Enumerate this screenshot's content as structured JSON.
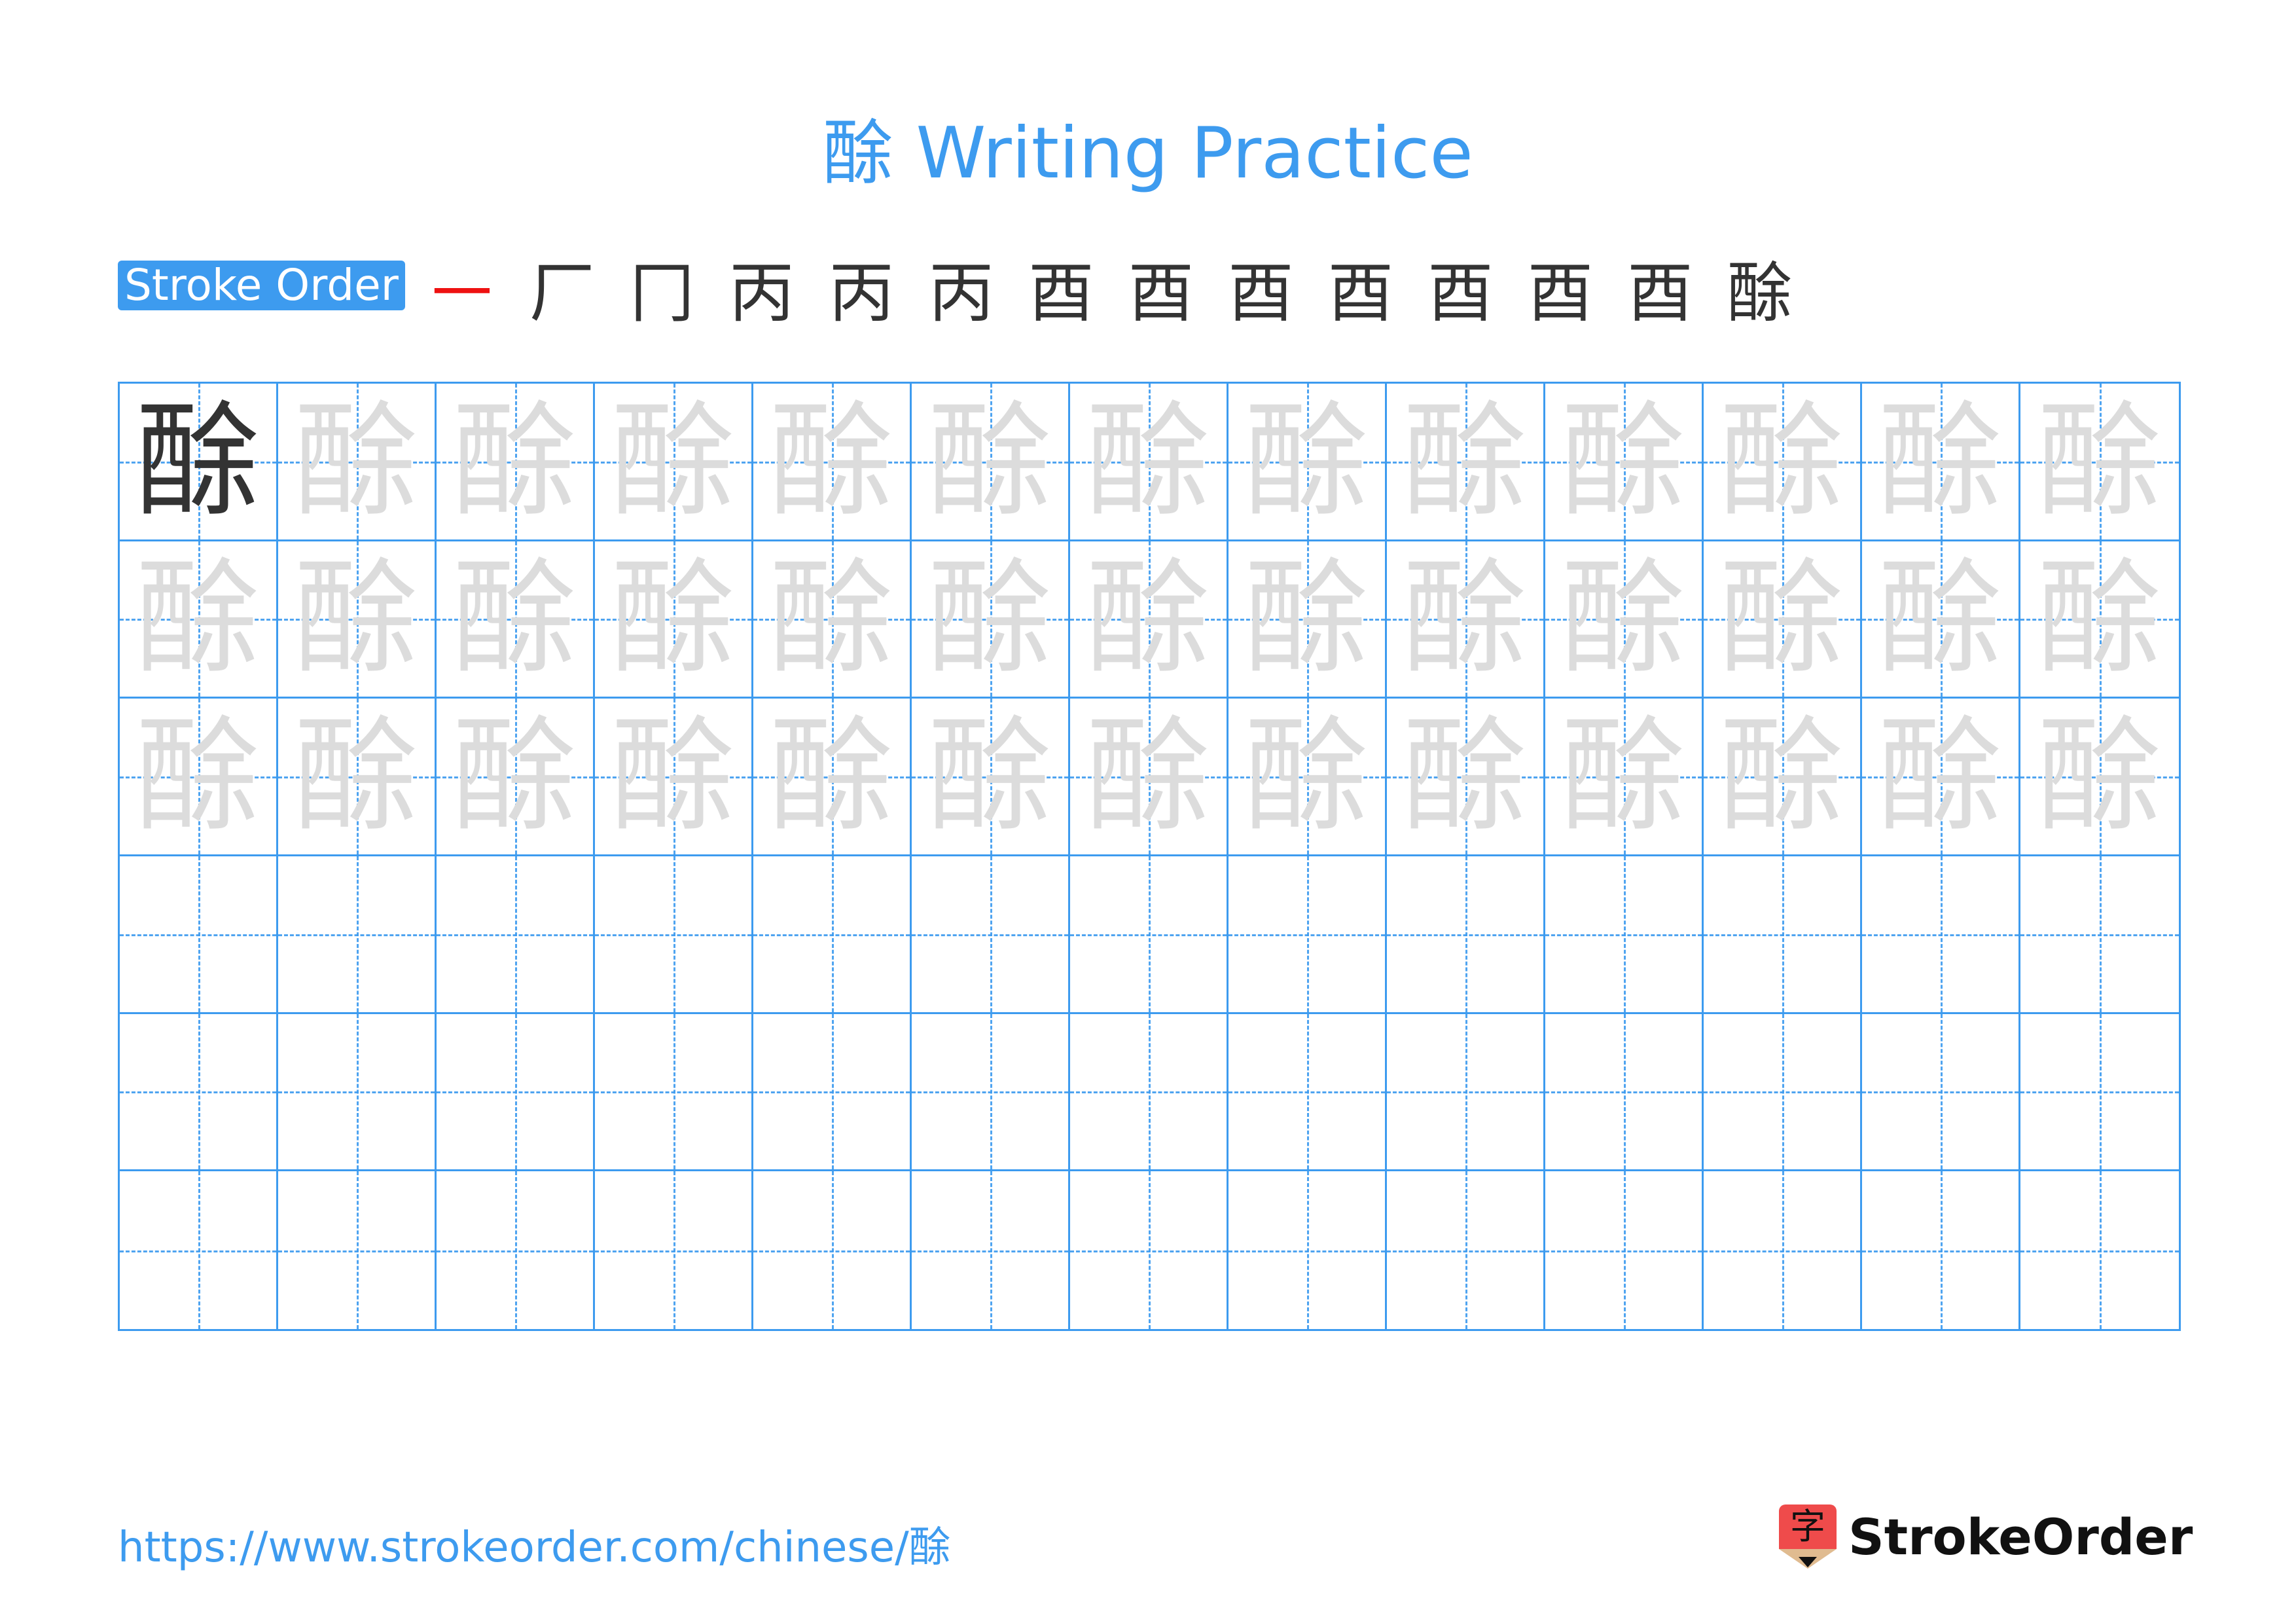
{
  "header": {
    "title": "酴 Writing Practice"
  },
  "stroke_order": {
    "label": "Stroke Order",
    "steps": [
      "㇐",
      "厂",
      "冂",
      "丙",
      "丙",
      "丙",
      "酉",
      "酉",
      "酉",
      "酉",
      "酉",
      "酉",
      "酉",
      "酴"
    ],
    "step_count": 14
  },
  "practice_grid": {
    "character": "酴",
    "columns": 13,
    "rows": 6,
    "model_cells": 1,
    "trace_rows": 3,
    "blank_rows": 3
  },
  "footer": {
    "url": "https://www.strokeorder.com/chinese/酴",
    "brand_icon_char": "字",
    "brand_name": "StrokeOrder"
  },
  "colors": {
    "accent": "#3d9bef",
    "stroke_highlight": "#ee1111",
    "model_char": "#333333",
    "trace_char": "#dcdcdc",
    "brand_red": "#ef4b4b"
  }
}
